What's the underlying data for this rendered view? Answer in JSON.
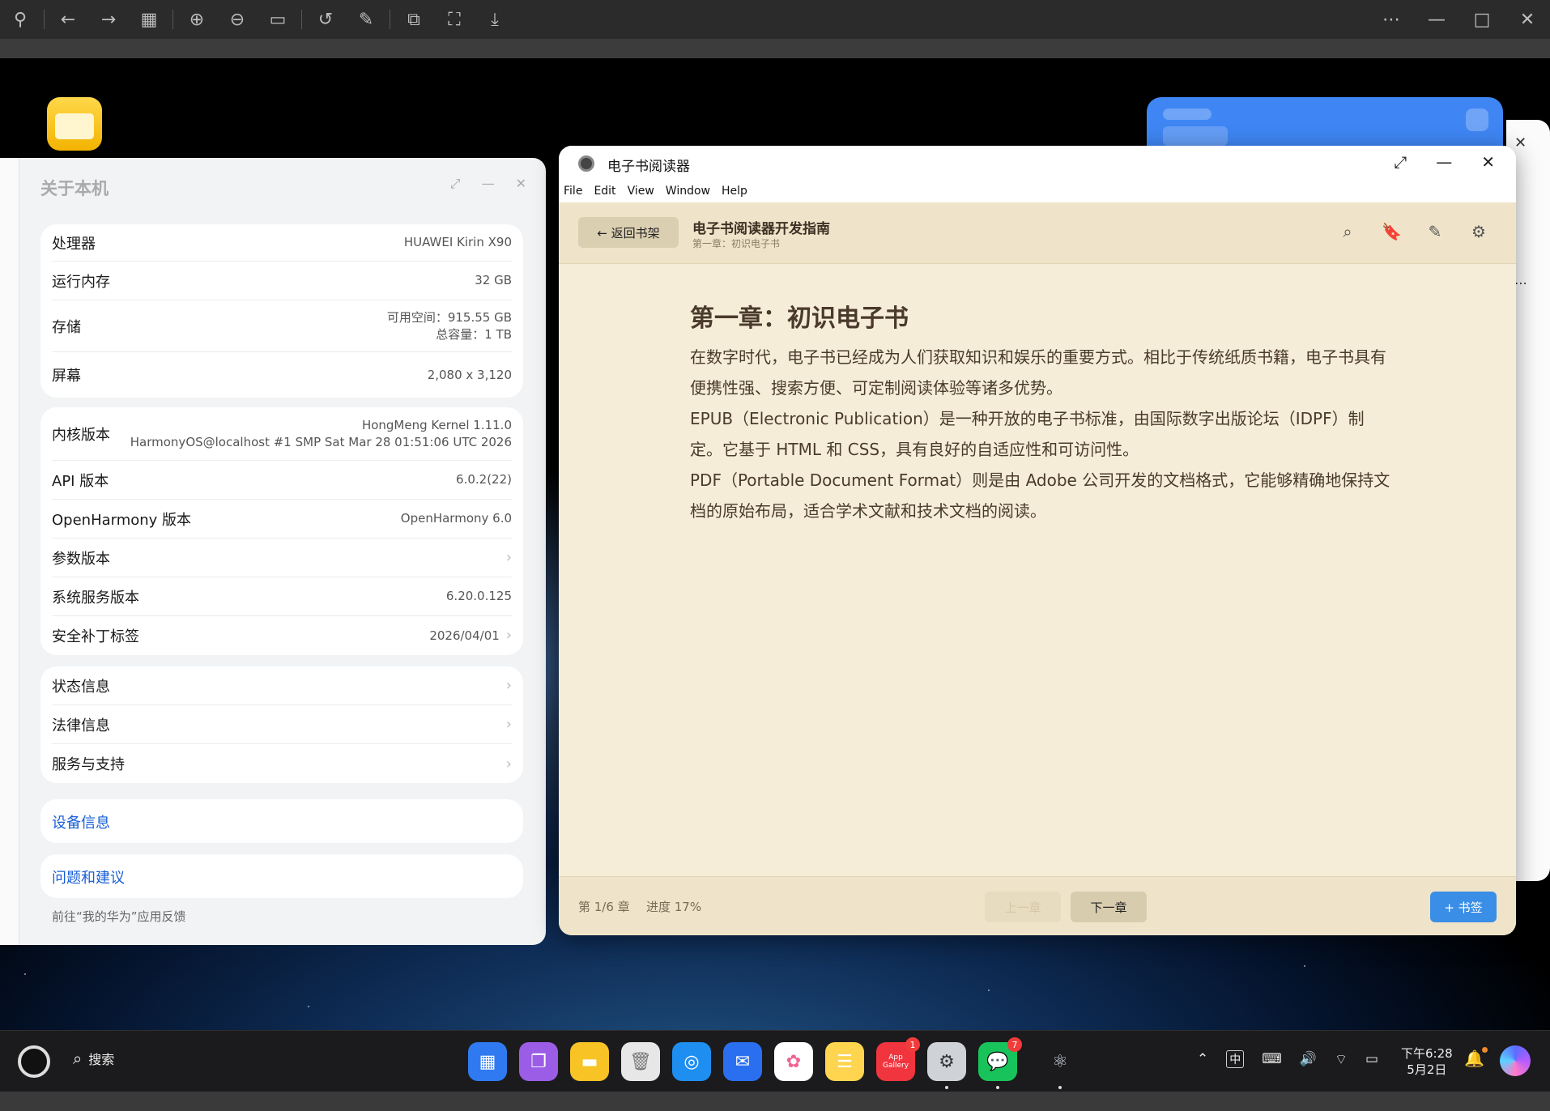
{
  "about": {
    "title": "关于本机",
    "card1": [
      {
        "label": "处理器",
        "value": "HUAWEI Kirin X90"
      },
      {
        "label": "运行内存",
        "value": "32 GB"
      },
      {
        "label": "存储",
        "value1": "可用空间：915.55 GB",
        "value2": "总容量：1 TB"
      },
      {
        "label": "屏幕",
        "value": "2,080 x 3,120"
      }
    ],
    "card2": [
      {
        "label": "内核版本",
        "value1": "HongMeng Kernel 1.11.0",
        "value2": "HarmonyOS@localhost #1 SMP Sat Mar 28 01:51:06 UTC 2026"
      },
      {
        "label": "API 版本",
        "value": "6.0.2(22)"
      },
      {
        "label": "OpenHarmony 版本",
        "value": "OpenHarmony 6.0"
      },
      {
        "label": "参数版本",
        "value": ""
      },
      {
        "label": "系统服务版本",
        "value": "6.20.0.125"
      },
      {
        "label": "安全补丁标签",
        "value": "2026/04/01"
      }
    ],
    "card3": [
      {
        "label": "状态信息"
      },
      {
        "label": "法律信息"
      },
      {
        "label": "服务与支持"
      }
    ],
    "device_info": "设备信息",
    "feedback": "问题和建议",
    "feedback_hint": "前往“我的华为”应用反馈"
  },
  "ebook": {
    "window_title": "电子书阅读器",
    "menu": [
      "File",
      "Edit",
      "View",
      "Window",
      "Help"
    ],
    "back_label": "← 返回书架",
    "book_title": "电子书阅读器开发指南",
    "chapter_subtitle": "第一章：初识电子书",
    "header_icons": [
      "search-icon",
      "bookmark-icon",
      "note-icon",
      "settings-icon"
    ],
    "chapter_heading": "第一章：初识电子书",
    "paragraphs": [
      "在数字时代，电子书已经成为人们获取知识和娱乐的重要方式。相比于传统纸质书籍，电子书具有便携性强、搜索方便、可定制阅读体验等诸多优势。",
      "EPUB（Electronic Publication）是一种开放的电子书标准，由国际数字出版论坛（IDPF）制定。它基于 HTML 和 CSS，具有良好的自适应性和可访问性。",
      "PDF（Portable Document Format）则是由 Adobe 公司开发的文档格式，它能够精确地保持文档的原始布局，适合学术文献和技术文档的阅读。"
    ],
    "chapter_info": "第 1/6 章",
    "progress_info": "进度 17%",
    "progress_percent": 17,
    "prev_label": "上一章",
    "next_label": "下一章",
    "bookmark_label": "+ 书签",
    "accent_color": "#3a8ee6"
  },
  "taskbar": {
    "search_label": "搜索",
    "apps": [
      {
        "name": "launcher-app",
        "badge": ""
      },
      {
        "name": "multitask-app",
        "badge": ""
      },
      {
        "name": "files-app",
        "badge": ""
      },
      {
        "name": "trash-app",
        "badge": ""
      },
      {
        "name": "browser-app",
        "badge": ""
      },
      {
        "name": "mail-app",
        "badge": ""
      },
      {
        "name": "photos-app",
        "badge": ""
      },
      {
        "name": "notes-app",
        "badge": ""
      },
      {
        "name": "app-gallery",
        "badge": "1",
        "label": "App Gallery"
      },
      {
        "name": "settings-app",
        "badge": ""
      },
      {
        "name": "wechat-app",
        "badge": "7"
      },
      {
        "name": "ebook-reader-app",
        "badge": ""
      }
    ],
    "ime": "中",
    "time": "下午6:28",
    "date": "5月2日"
  }
}
